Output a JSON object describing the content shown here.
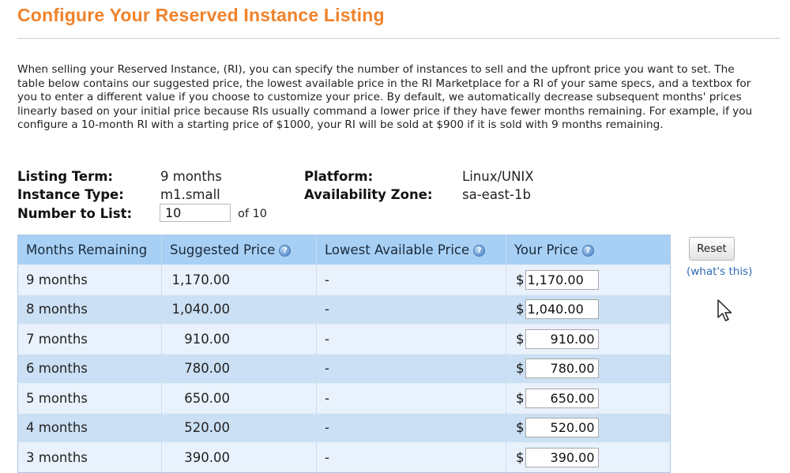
{
  "page": {
    "title": "Configure Your Reserved Instance Listing",
    "intro": "When selling your Reserved Instance, (RI), you can specify the number of instances to sell and the upfront price you want to set. The table below contains our suggested price, the lowest available price in the RI Marketplace for a RI of your same specs, and a textbox for you to enter a different value if you choose to customize your price. By default, we automatically decrease subsequent months' prices linearly based on your initial price because RIs usually command a lower price if they have fewer months remaining. For example, if you configure a 10-month RI with a starting price of $1000, your RI will be sold at $900 if it is sold with 9 months remaining."
  },
  "listing": {
    "term_label": "Listing Term:",
    "term_value": "9 months",
    "type_label": "Instance Type:",
    "type_value": "m1.small",
    "number_label": "Number to List:",
    "number_value": "10",
    "of_text": "of 10",
    "platform_label": "Platform:",
    "platform_value": "Linux/UNIX",
    "zone_label": "Availability Zone:",
    "zone_value": "sa-east-1b"
  },
  "table": {
    "headers": {
      "months": "Months Remaining",
      "suggested": "Suggested Price",
      "lowest": "Lowest Available Price",
      "yours": "Your Price"
    },
    "currency_symbol": "$",
    "rows": [
      {
        "months": "9 months",
        "suggested": "1,170.00",
        "lowest": "-",
        "price": "1,170.00"
      },
      {
        "months": "8 months",
        "suggested": "1,040.00",
        "lowest": "-",
        "price": "1,040.00"
      },
      {
        "months": "7 months",
        "suggested": "910.00",
        "lowest": "-",
        "price": "910.00"
      },
      {
        "months": "6 months",
        "suggested": "780.00",
        "lowest": "-",
        "price": "780.00"
      },
      {
        "months": "5 months",
        "suggested": "650.00",
        "lowest": "-",
        "price": "650.00"
      },
      {
        "months": "4 months",
        "suggested": "520.00",
        "lowest": "-",
        "price": "520.00"
      },
      {
        "months": "3 months",
        "suggested": "390.00",
        "lowest": "-",
        "price": "390.00"
      }
    ]
  },
  "controls": {
    "reset_label": "Reset",
    "whats_this": "(what's this)"
  },
  "icons": {
    "help": "help-icon",
    "cursor": "mouse-pointer-icon"
  },
  "colors": {
    "title": "#f0822a",
    "header_bg": "#a8d0f5",
    "row_light": "#e9f2fc",
    "row_dark": "#cbe0f4",
    "link": "#2f6bb5"
  }
}
